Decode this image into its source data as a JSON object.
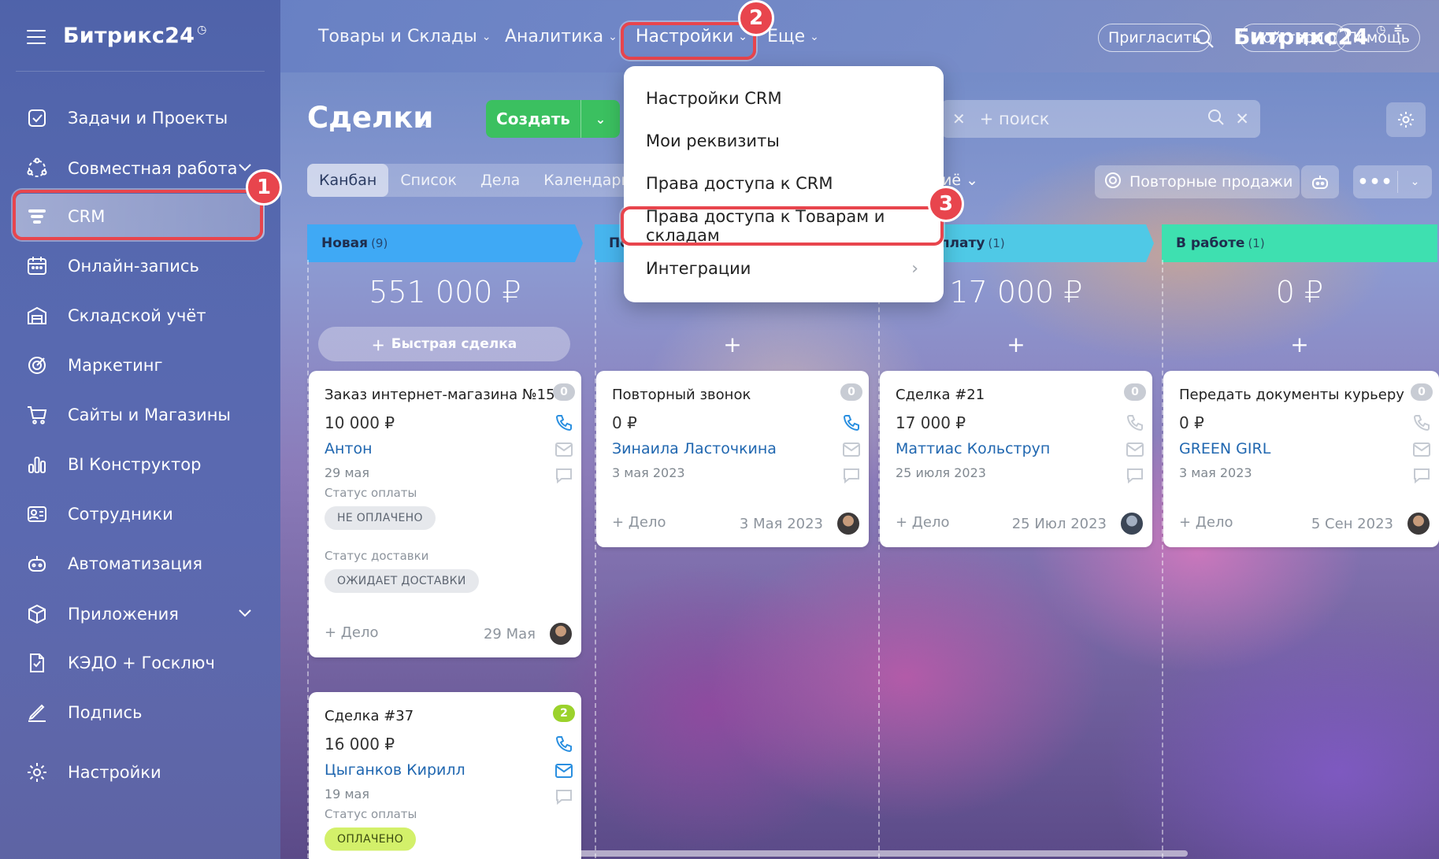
{
  "sidebar": {
    "brand": "Битрикс24",
    "brand_mark": "◷",
    "items": [
      {
        "label": "Задачи и Проекты",
        "icon": "tasks-icon"
      },
      {
        "label": "Совместная работа",
        "icon": "collab-icon",
        "chevron": "⌄"
      },
      {
        "label": "CRM",
        "icon": "crm-funnel-icon"
      },
      {
        "label": "Онлайн-запись",
        "icon": "booking-icon"
      },
      {
        "label": "Складской учёт",
        "icon": "warehouse-icon"
      },
      {
        "label": "Маркетинг",
        "icon": "marketing-icon"
      },
      {
        "label": "Сайты и Магазины",
        "icon": "cart-icon"
      },
      {
        "label": "BI Конструктор",
        "icon": "bi-chart-icon"
      },
      {
        "label": "Сотрудники",
        "icon": "employees-icon"
      },
      {
        "label": "Автоматизация",
        "icon": "automation-icon"
      },
      {
        "label": "Приложения",
        "icon": "apps-icon",
        "chevron": "⌄"
      },
      {
        "label": "КЭДО + Госключ",
        "icon": "kedo-icon"
      },
      {
        "label": "Подпись",
        "icon": "signature-icon"
      },
      {
        "label": "Настройки",
        "icon": "settings-icon"
      }
    ]
  },
  "topnav": {
    "items": [
      "Товары и Склады",
      "Аналитика",
      "Настройки",
      "Еще"
    ],
    "brand": "Битрикс24",
    "brand_mark": "◷",
    "invite": "Пригласить",
    "tariff": "Мой тариф",
    "help": "Помощь"
  },
  "header": {
    "title": "Сделки",
    "create": "Создать",
    "search_placeholder": "+ поиск",
    "views": [
      "Канбан",
      "Список",
      "Дела",
      "Календарь"
    ],
    "stage_filter": "иё ⌄",
    "repeat_sales": "Повторные продажи",
    "more": "•••"
  },
  "dropdown": {
    "items": [
      "Настройки CRM",
      "Мои реквизиты",
      "Права доступа к CRM",
      "Права доступа к Товарам и складам",
      "Интеграции"
    ],
    "submenu_arrow": "›"
  },
  "callouts": [
    "1",
    "2",
    "3"
  ],
  "columns": [
    {
      "name": "Новая",
      "count": "(9)",
      "sum": "551 000 ₽",
      "color": "#3fa9f5",
      "quick": "Быстрая сделка",
      "cards": [
        {
          "title": "Заказ интернет-магазина №15",
          "badge": "0",
          "price": "10 000 ₽",
          "client": "Антон",
          "date": "29 мая",
          "pay_label": "Статус оплаты",
          "pay_status": "НЕ ОПЛАЧЕНО",
          "ship_label": "Статус доставки",
          "ship_status": "ОЖИДАЕТ ДОСТАВКИ",
          "task": "+ Дело",
          "task_date": "29 Мая"
        },
        {
          "title": "Сделка #37",
          "badge": "2",
          "price": "16 000 ₽",
          "client": "Цыганков Кирилл",
          "date": "19 мая",
          "pay_label": "Статус оплаты",
          "pay_status": "ОПЛАЧЕНО"
        }
      ]
    },
    {
      "name": "По",
      "count": "",
      "sum": "",
      "color": "#47b5ee",
      "plus": "+",
      "cards": [
        {
          "title": "Повторный звонок",
          "badge": "0",
          "price": "0 ₽",
          "client": "Зинаила Ласточкина",
          "date": "3 мая 2023",
          "task": "+ Дело",
          "task_date": "3 Мая 2023"
        }
      ]
    },
    {
      "name": "предоплату",
      "count": "(1)",
      "sum": "17 000 ₽",
      "color": "#4fc9e6",
      "plus": "+",
      "cards": [
        {
          "title": "Сделка #21",
          "badge": "0",
          "price": "17 000 ₽",
          "client": "Маттиас Кольструп",
          "date": "25 июля 2023",
          "task": "+ Дело",
          "task_date": "25 Июл 2023"
        }
      ]
    },
    {
      "name": "В работе",
      "count": "(1)",
      "sum": "0 ₽",
      "color": "#3ee0b0",
      "plus": "+",
      "cards": [
        {
          "title": "Передать документы курьеру",
          "badge": "0",
          "price": "0 ₽",
          "client": "GREEN GIRL",
          "date": "3 мая 2023",
          "task": "+ Дело",
          "task_date": "5 Сен 2023"
        }
      ]
    }
  ]
}
